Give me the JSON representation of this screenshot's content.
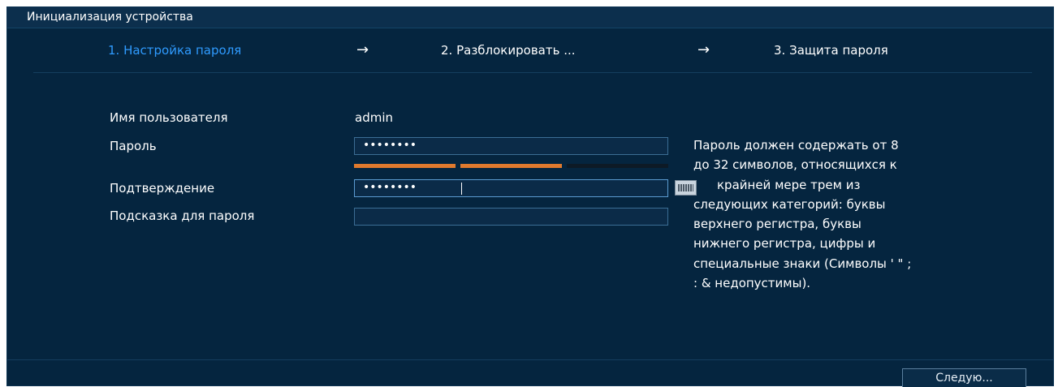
{
  "window": {
    "title": "Инициализация устройства"
  },
  "steps": [
    {
      "label": "1.  Настройка пароля",
      "active": true
    },
    {
      "label": "2.  Разблокировать ...",
      "active": false
    },
    {
      "label": "3.  Защита пароля",
      "active": false
    }
  ],
  "step_arrow": "→",
  "form": {
    "username_label": "Имя пользователя",
    "username_value": "admin",
    "password_label": "Пароль",
    "password_value": "••••••••",
    "confirm_label": "Подтверждение",
    "confirm_value": "••••••••",
    "hint_label": "Подсказка для пароля",
    "hint_value": ""
  },
  "strength": {
    "level": 2,
    "max": 3,
    "fill_color": "#e07a2e",
    "empty_color": "#0d1a26"
  },
  "help_text": [
    "Пароль должен содержать от 8",
    "до 32 символов, относящихся к",
    "крайней мере трем из",
    "следующих категорий: буквы",
    "верхнего регистра, буквы",
    "нижнего регистра, цифры и",
    "специальные знаки (Символы ' \" ;",
    ": & недопустимы)."
  ],
  "footer": {
    "next_label": "Следую..."
  },
  "colors": {
    "background": "#05253f",
    "accent": "#2f9bff"
  }
}
